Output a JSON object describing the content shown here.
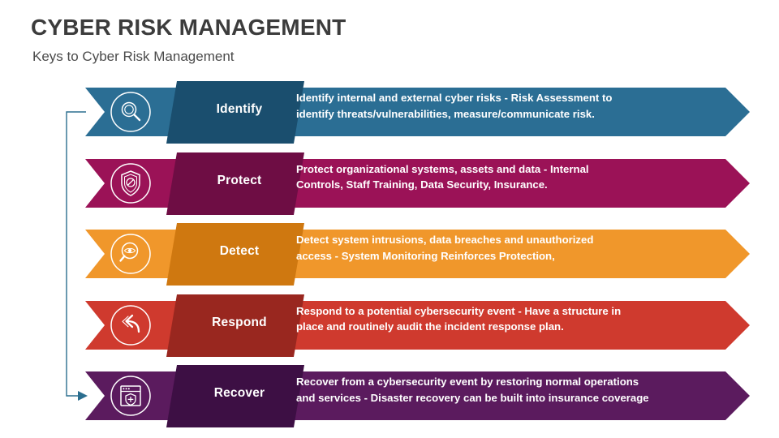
{
  "header": {
    "title": "CYBER RISK MANAGEMENT",
    "subtitle": "Keys to Cyber Risk Management"
  },
  "colors": {
    "title_color": "#3c3c3c",
    "subtitle_color": "#4a4a4a",
    "connector_color": "#2b6e8f",
    "background": "#ffffff"
  },
  "steps": [
    {
      "label": "Identify",
      "icon": "magnifier-icon",
      "desc_line1": "Identify internal and external cyber risks - Risk Assessment to",
      "desc_line2": "identify threats/vulnerabilities, measure/communicate risk.",
      "base_color": "#2b6e94",
      "band_color": "#1a4e6e"
    },
    {
      "label": "Protect",
      "icon": "shield-check-icon",
      "desc_line1": "Protect organizational systems, assets and data - Internal",
      "desc_line2": "Controls, Staff Training, Data Security, Insurance.",
      "base_color": "#9b1257",
      "band_color": "#6e0d44"
    },
    {
      "label": "Detect",
      "icon": "magnifier-eye-icon",
      "desc_line1": "Detect system intrusions, data breaches and unauthorized",
      "desc_line2": "access - System Monitoring Reinforces Protection,",
      "base_color": "#f0972b",
      "band_color": "#cf7810"
    },
    {
      "label": "Respond",
      "icon": "reply-arrow-icon",
      "desc_line1": "Respond to a potential cybersecurity event - Have a structure in",
      "desc_line2": "place and routinely audit the incident response plan.",
      "base_color": "#cf3a2e",
      "band_color": "#99271f"
    },
    {
      "label": "Recover",
      "icon": "window-shield-icon",
      "desc_line1": "Recover from a cybersecurity event by restoring normal operations",
      "desc_line2": "and services - Disaster recovery can be built into insurance coverage",
      "base_color": "#5b1b5e",
      "band_color": "#3d0f44"
    }
  ]
}
